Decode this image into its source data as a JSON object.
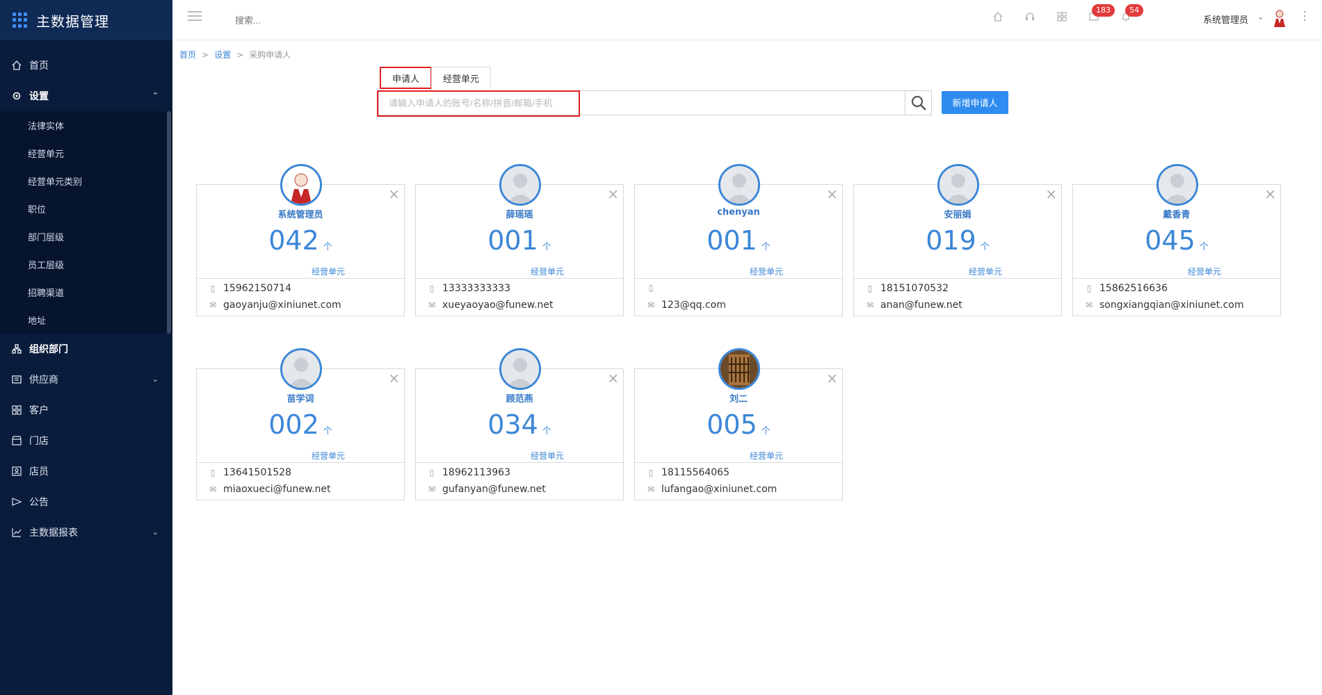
{
  "app": {
    "title": "主数据管理"
  },
  "sidebar": {
    "items": [
      {
        "label": "首页",
        "icon": "home-icon"
      },
      {
        "label": "设置",
        "icon": "gear-icon",
        "expanded": true,
        "children": [
          "法律实体",
          "经营单元",
          "经营单元类别",
          "职位",
          "部门层级",
          "员工层级",
          "招聘渠道",
          "地址"
        ]
      },
      {
        "label": "组织部门",
        "icon": "org-chart-icon"
      },
      {
        "label": "供应商",
        "icon": "supplier-icon",
        "has_children": true
      },
      {
        "label": "客户",
        "icon": "customer-icon"
      },
      {
        "label": "门店",
        "icon": "store-icon"
      },
      {
        "label": "店员",
        "icon": "clerk-icon"
      },
      {
        "label": "公告",
        "icon": "announcement-icon"
      },
      {
        "label": "主数据报表",
        "icon": "report-icon",
        "has_children": true
      }
    ]
  },
  "topbar": {
    "search_placeholder": "搜索...",
    "badge_messages": "183",
    "badge_notifications": "54",
    "user_name": "系统管理员"
  },
  "breadcrumb": {
    "home": "首页",
    "settings": "设置",
    "current": "采购申请人"
  },
  "tabs": [
    {
      "label": "申请人",
      "active": true
    },
    {
      "label": "经营单元",
      "active": false
    }
  ],
  "search": {
    "placeholder": "请输入申请人的账号/名称/拼音/邮箱/手机",
    "value": ""
  },
  "add_button": "新增申请人",
  "accent_color": "#3b86d8",
  "cards": [
    {
      "name": "系统管理员",
      "count": "042",
      "unit": "个",
      "count_label": "经营单元",
      "phone": "15962150714",
      "email": "gaoyanju@xiniunet.com",
      "avatar": "admin"
    },
    {
      "name": "薛瑶瑶",
      "count": "001",
      "unit": "个",
      "count_label": "经营单元",
      "phone": "13333333333",
      "email": "xueyaoyao@funew.net",
      "avatar": "default"
    },
    {
      "name": "chenyan",
      "count": "001",
      "unit": "个",
      "count_label": "经营单元",
      "phone": "",
      "email": "123@qq.com",
      "avatar": "default"
    },
    {
      "name": "安丽娟",
      "count": "019",
      "unit": "个",
      "count_label": "经营单元",
      "phone": "18151070532",
      "email": "anan@funew.net",
      "avatar": "default"
    },
    {
      "name": "戴香青",
      "count": "045",
      "unit": "个",
      "count_label": "经营单元",
      "phone": "15862516636",
      "email": "songxiangqian@xiniunet.com",
      "avatar": "default"
    },
    {
      "name": "苗学词",
      "count": "002",
      "unit": "个",
      "count_label": "经营单元",
      "phone": "13641501528",
      "email": "miaoxueci@funew.net",
      "avatar": "default"
    },
    {
      "name": "顾范燕",
      "count": "034",
      "unit": "个",
      "count_label": "经营单元",
      "phone": "18962113963",
      "email": "gufanyan@funew.net",
      "avatar": "default"
    },
    {
      "name": "刘二",
      "count": "005",
      "unit": "个",
      "count_label": "经营单元",
      "phone": "18115564065",
      "email": "lufangao@xiniunet.com",
      "avatar": "photo"
    }
  ]
}
